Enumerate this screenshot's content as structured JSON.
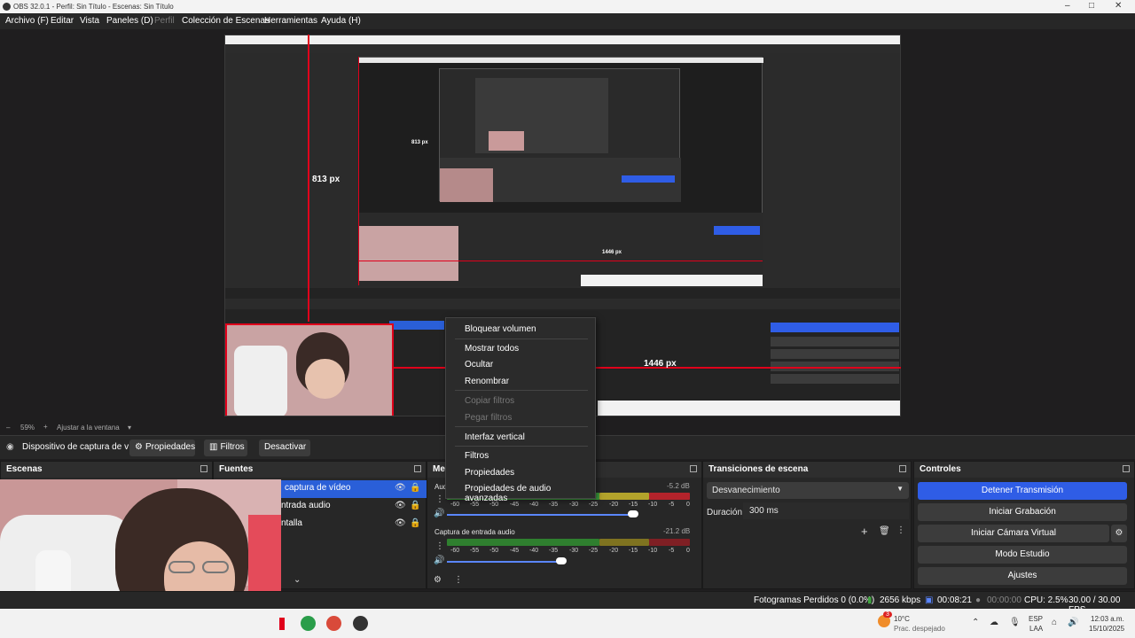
{
  "window": {
    "title": "OBS 32.0.1 - Perfil: Sin Título - Escenas: Sin Título",
    "minimize_icon": "–",
    "maximize_icon": "□",
    "close_icon": "✕"
  },
  "menu": {
    "items": [
      "Archivo (F)",
      "Editar",
      "Vista",
      "Paneles (D)",
      "Perfil",
      "Colección de Escenas",
      "Herramientas",
      "Ayuda (H)"
    ]
  },
  "preview": {
    "measure_vertical": "813 px",
    "measure_horizontal": "1446 px",
    "nested_label_a": "813 px",
    "nested_label_b": "1446 px"
  },
  "zoom": {
    "percent": "59%",
    "fit_label": "Ajustar a la ventana"
  },
  "source_toolbar": {
    "source_name": "Dispositivo de captura de v",
    "properties": "Propiedades",
    "filters": "Filtros",
    "deactivate": "Desactivar"
  },
  "docks": {
    "scenes_title": "Escenas",
    "sources_title": "Fuentes",
    "mixer_title": "Me",
    "transitions_title": "Transiciones de escena",
    "controls_title": "Controles"
  },
  "sources": {
    "items": [
      {
        "label": "captura de vídeo",
        "selected": true
      },
      {
        "label": "ntrada audio",
        "selected": false
      },
      {
        "label": "ntalla",
        "selected": false
      }
    ]
  },
  "mixer": {
    "channel1": {
      "name": "Aud",
      "db": "-5.2 dB"
    },
    "channel2": {
      "name": "Captura de entrada audio",
      "db": "-21.2 dB"
    },
    "ticks": [
      "-60",
      "-55",
      "-50",
      "-45",
      "-40",
      "-35",
      "-30",
      "-25",
      "-20",
      "-15",
      "-10",
      "-5",
      "0"
    ]
  },
  "transitions": {
    "selected": "Desvanecimiento",
    "duration_label": "Duración",
    "duration_value": "300 ms"
  },
  "controls": {
    "stop_stream": "Detener Transmisión",
    "start_record": "Iniciar Grabación",
    "start_vcam": "Iniciar Cámara Virtual",
    "studio_mode": "Modo Estudio",
    "settings": "Ajustes"
  },
  "context_menu": {
    "items": [
      {
        "label": "Bloquear volumen",
        "enabled": true
      },
      {
        "label": "Mostrar todos",
        "enabled": true
      },
      {
        "label": "Ocultar",
        "enabled": true
      },
      {
        "label": "Renombrar",
        "enabled": true
      },
      {
        "label": "Copiar filtros",
        "enabled": false
      },
      {
        "label": "Pegar filtros",
        "enabled": false
      },
      {
        "label": "Interfaz vertical",
        "enabled": true
      },
      {
        "label": "Filtros",
        "enabled": true
      },
      {
        "label": "Propiedades",
        "enabled": true
      },
      {
        "label": "Propiedades de audio avanzadas",
        "enabled": true
      }
    ]
  },
  "status": {
    "dropped_frames": "Fotogramas Perdidos 0 (0.0%)",
    "bitrate": "2656 kbps",
    "time": "00:08:21",
    "rec_time": "00:00:00",
    "cpu": "CPU: 2.5%",
    "fps": "30.00 / 30.00 FPS"
  },
  "taskbar": {
    "weather_temp": "10°C",
    "weather_desc": "Prac. despejado",
    "lang": "ESP",
    "region": "LAA",
    "clock_time": "12:03 a.m.",
    "clock_date": "15/10/2025",
    "notification_badge": "3"
  },
  "colors": {
    "accent_blue": "#2f5de6",
    "red_guide": "#e0001b",
    "meter_green": "#3fa33f",
    "meter_yellow": "#b3a32b",
    "meter_red": "#b3232b"
  }
}
